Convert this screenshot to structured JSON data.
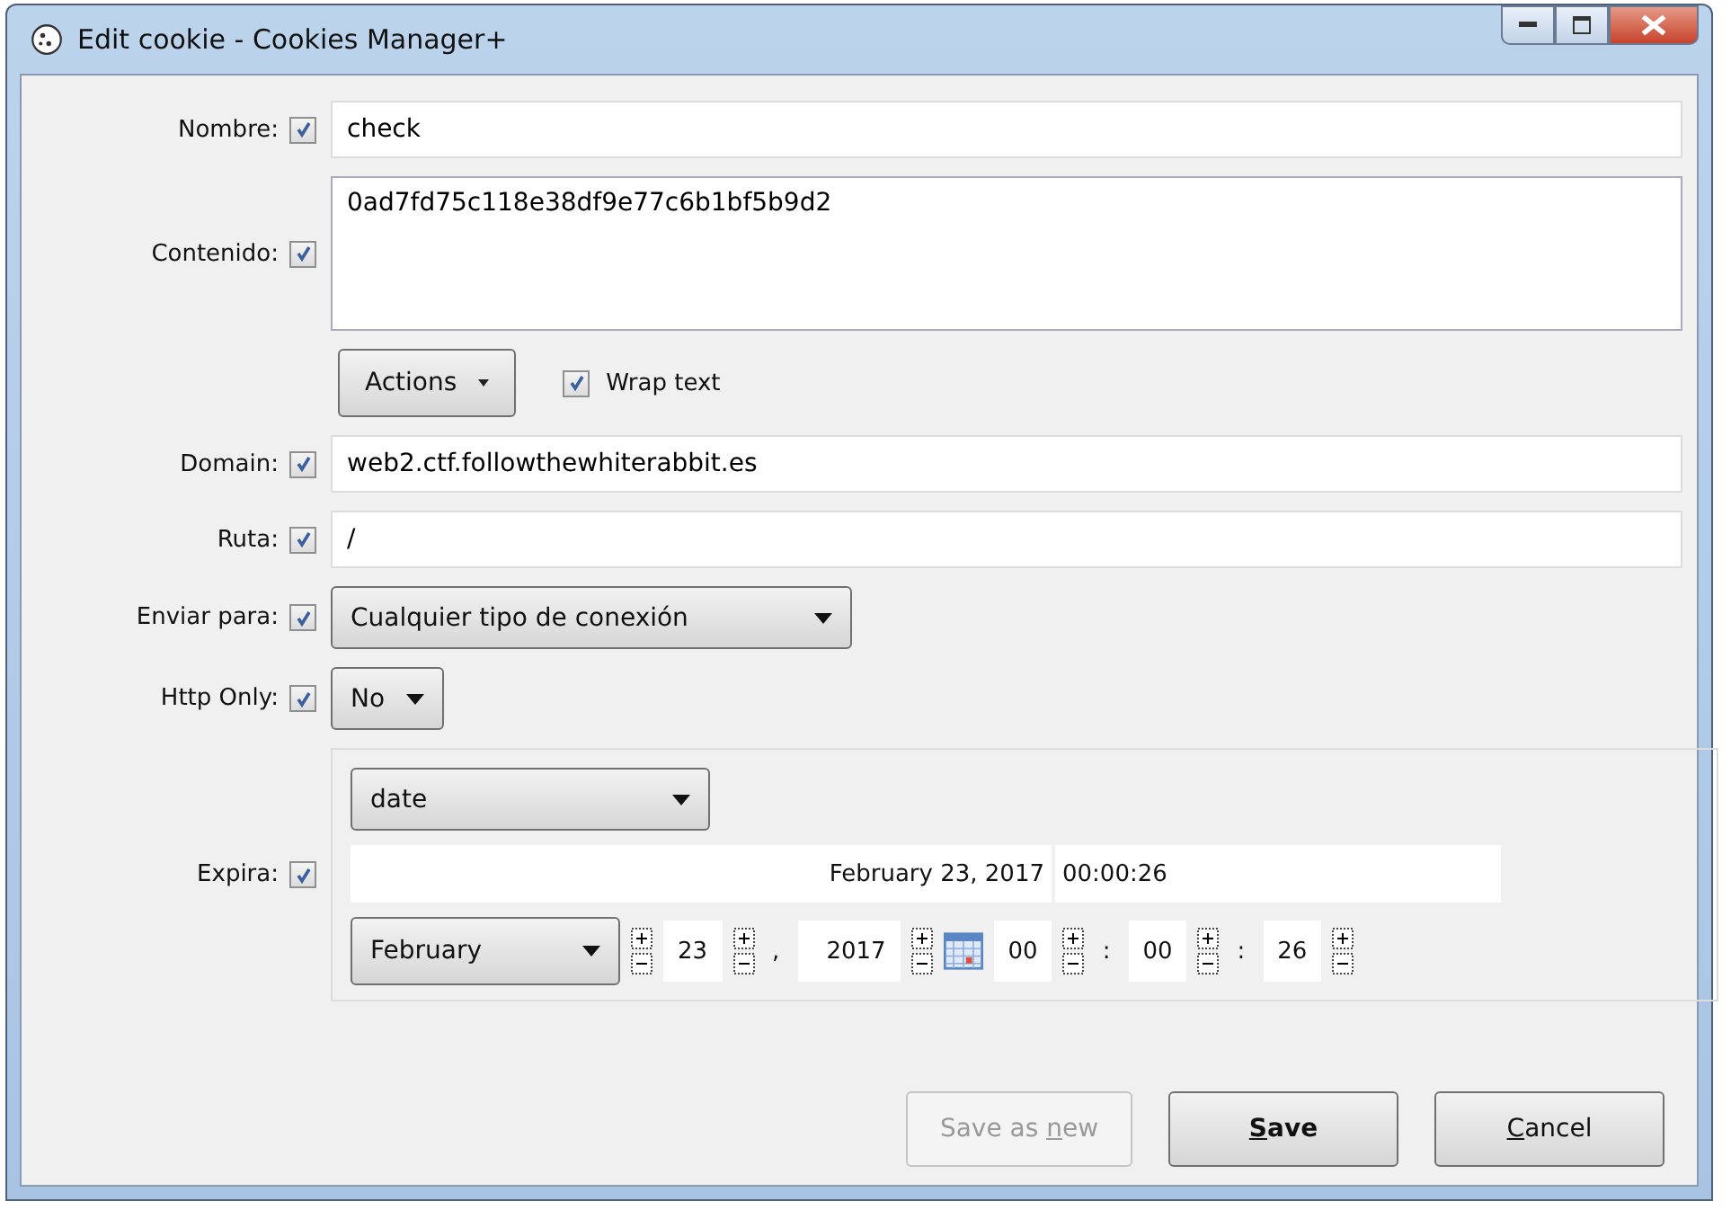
{
  "window": {
    "title": "Edit cookie - Cookies Manager+"
  },
  "fields": [
    {
      "kind": "text",
      "label": "Nombre:",
      "checked": true,
      "value": "check"
    },
    {
      "kind": "textarea",
      "label": "Contenido:",
      "checked": true,
      "value": "0ad7fd75c118e38df9e77c6b1bf5b9d2"
    },
    {
      "kind": "actions",
      "button": "Actions",
      "wrap_label": "Wrap text",
      "wrap_checked": true
    },
    {
      "kind": "text",
      "label": "Domain:",
      "checked": true,
      "value": "web2.ctf.followthewhiterabbit.es"
    },
    {
      "kind": "text",
      "label": "Ruta:",
      "checked": true,
      "value": "/"
    },
    {
      "kind": "select",
      "label": "Enviar para:",
      "checked": true,
      "value": "Cualquier tipo de conexión",
      "wide": true
    },
    {
      "kind": "select",
      "label": "Http Only:",
      "checked": true,
      "value": "No",
      "wide": false
    },
    {
      "kind": "expires",
      "label": "Expira:",
      "checked": true,
      "type": "date",
      "date_text": "February 23, 2017",
      "time_text": "00:00:26",
      "month": "February",
      "day": "23",
      "comma": ",",
      "year": "2017",
      "hour": "00",
      "minute": "00",
      "second": "26",
      "sep": ":"
    }
  ],
  "buttons": [
    {
      "before": "Save as ",
      "key": "n",
      "after": "ew",
      "disabled": true,
      "default": false
    },
    {
      "key": "S",
      "after": "ave",
      "disabled": false,
      "default": true
    },
    {
      "key": "C",
      "after": "ancel",
      "disabled": false,
      "default": false
    }
  ]
}
